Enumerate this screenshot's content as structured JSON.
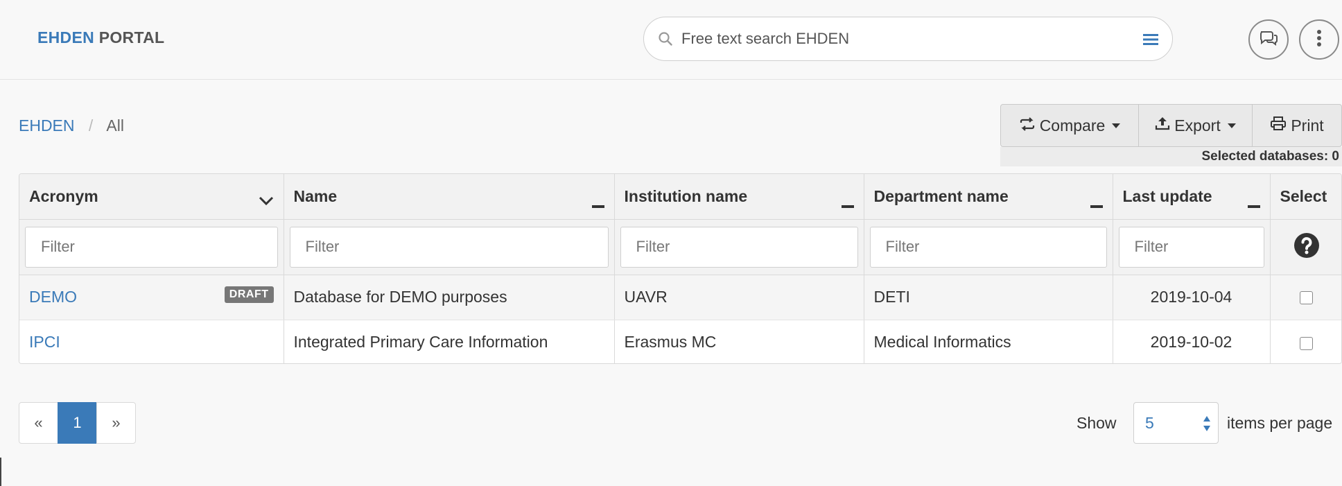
{
  "header": {
    "brand_primary": "EHDEN",
    "brand_secondary": "PORTAL",
    "search_placeholder": "Free text search EHDEN",
    "icons": [
      "search-icon",
      "hamburger-menu-icon",
      "chat-icon",
      "more-vertical-icon"
    ]
  },
  "breadcrumb": {
    "root": "EHDEN",
    "separator": "/",
    "current": "All"
  },
  "toolbar": {
    "compare_label": "Compare",
    "export_label": "Export",
    "print_label": "Print",
    "selected_databases": "Selected databases: 0"
  },
  "table": {
    "columns": [
      {
        "label": "Acronym",
        "control": "chevron-down-icon"
      },
      {
        "label": "Name",
        "control": "minus-icon"
      },
      {
        "label": "Institution name",
        "control": "minus-icon"
      },
      {
        "label": "Department name",
        "control": "minus-icon"
      },
      {
        "label": "Last update",
        "control": "minus-icon"
      },
      {
        "label": "Select",
        "control": ""
      }
    ],
    "filter_placeholder": "Filter",
    "rows": [
      {
        "acronym": "DEMO",
        "badge": "DRAFT",
        "name": "Database for DEMO purposes",
        "institution": "UAVR",
        "department": "DETI",
        "last_update": "2019-10-04",
        "selected": false
      },
      {
        "acronym": "IPCI",
        "badge": "",
        "name": "Integrated Primary Care Information",
        "institution": "Erasmus MC",
        "department": "Medical Informatics",
        "last_update": "2019-10-02",
        "selected": false
      }
    ]
  },
  "pagination": {
    "prev": "«",
    "current_page": "1",
    "next": "»"
  },
  "page_size": {
    "show_label": "Show",
    "value": "5",
    "suffix": "items per page"
  },
  "colors": {
    "accent": "#3a7ab8",
    "badge": "#777777"
  }
}
